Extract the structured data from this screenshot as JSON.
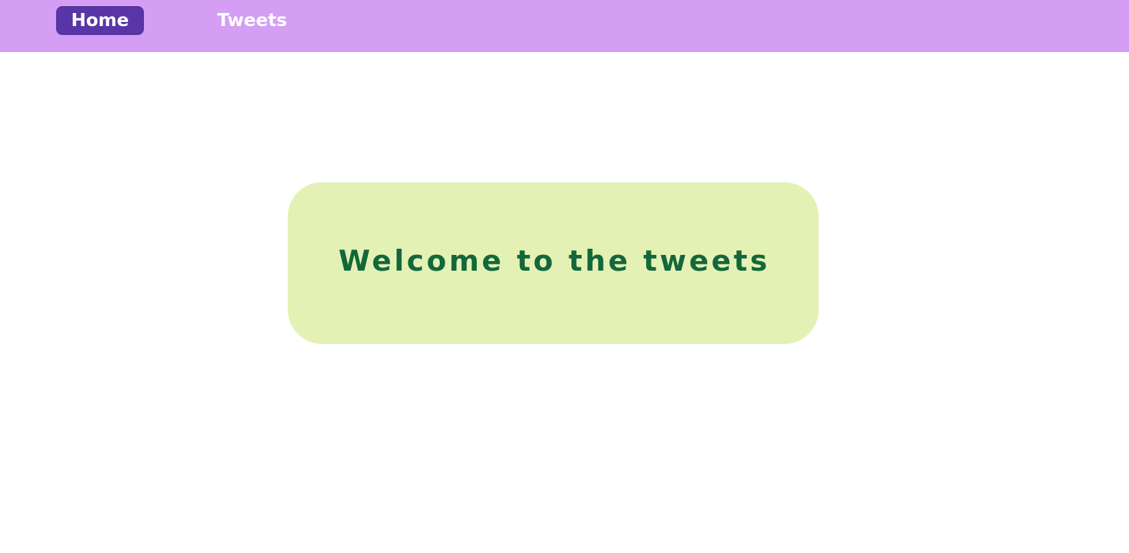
{
  "nav": {
    "items": [
      {
        "label": "Home",
        "active": true
      },
      {
        "label": "Tweets",
        "active": false
      }
    ]
  },
  "main": {
    "welcome_text": "Welcome to the tweets"
  },
  "colors": {
    "nav_background": "#d39ef3",
    "active_nav_background": "#5a35a8",
    "card_background": "#e4f1b5",
    "title_text": "#13683b"
  }
}
